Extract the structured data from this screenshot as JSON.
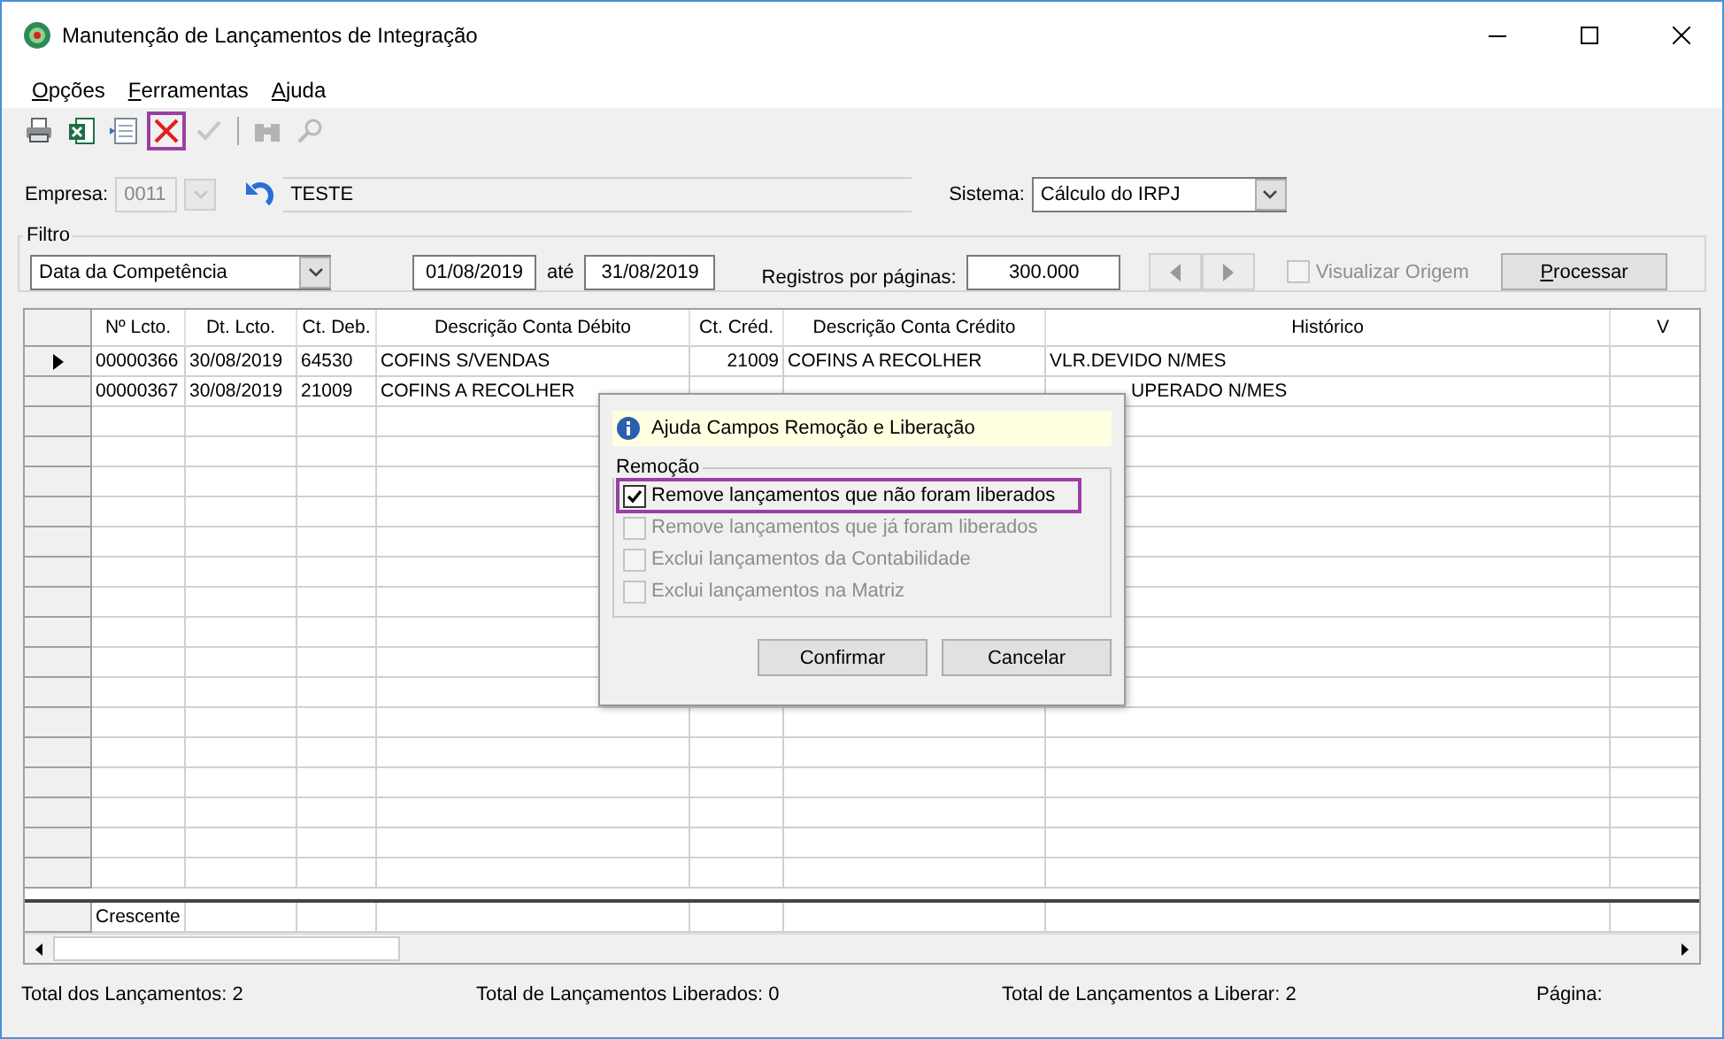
{
  "window": {
    "title": "Manutenção de Lançamentos de Integração"
  },
  "menu": [
    "Opções",
    "Ferramentas",
    "Ajuda"
  ],
  "toolbar": [
    {
      "kind": "printer",
      "disabled": false,
      "highlighted": false
    },
    {
      "kind": "excel",
      "disabled": false,
      "highlighted": false
    },
    {
      "kind": "notes",
      "disabled": false,
      "highlighted": false
    },
    {
      "kind": "delete",
      "disabled": false,
      "highlighted": true
    },
    {
      "kind": "check",
      "disabled": true,
      "highlighted": false
    },
    {
      "kind": "separator"
    },
    {
      "kind": "binoculars",
      "disabled": true,
      "highlighted": false
    },
    {
      "kind": "magnifier",
      "disabled": true,
      "highlighted": false
    }
  ],
  "empresa": {
    "label": "Empresa:",
    "code": "0011",
    "name": "TESTE"
  },
  "sistema": {
    "label": "Sistema:",
    "value": "Cálculo do IRPJ"
  },
  "filtro": {
    "title": "Filtro",
    "field": "Data da Competência",
    "date_from": "01/08/2019",
    "until_label": "até",
    "date_to": "31/08/2019",
    "per_page_label": "Registros por páginas:",
    "per_page": "300.000",
    "visualizar": {
      "label": "Visualizar Origem",
      "checked": false,
      "disabled": true
    },
    "process_button": "Processar"
  },
  "grid": {
    "columns": [
      "Nº Lcto.",
      "Dt. Lcto.",
      "Ct. Deb.",
      "Descrição Conta Débito",
      "Ct. Créd.",
      "Descrição Conta Crédito",
      "Histórico",
      "V"
    ],
    "rows": [
      {
        "selected": true,
        "covered_by_dialog": false,
        "cells": [
          "00000366",
          "30/08/2019",
          "64530",
          "COFINS S/VENDAS",
          "21009",
          "COFINS A RECOLHER",
          "VLR.DEVIDO N/MES"
        ]
      },
      {
        "selected": false,
        "covered_by_dialog": true,
        "cells": [
          "00000367",
          "30/08/2019",
          "21009",
          "COFINS A RECOLHER",
          null,
          null,
          "UPERADO N/MES"
        ]
      }
    ],
    "footer": "Crescente"
  },
  "dialog": {
    "title": "Ajuda Campos Remoção e Liberação",
    "group": "Remoção",
    "options": [
      {
        "label": "Remove lançamentos que não foram liberados",
        "checked": true,
        "disabled": false,
        "highlighted": true
      },
      {
        "label": "Remove lançamentos que já foram liberados",
        "checked": false,
        "disabled": true,
        "highlighted": false
      },
      {
        "label": "Exclui lançamentos da Contabilidade",
        "checked": false,
        "disabled": true,
        "highlighted": false
      },
      {
        "label": "Exclui lançamentos na Matriz",
        "checked": false,
        "disabled": true,
        "highlighted": false
      }
    ],
    "buttons": [
      "Confirmar",
      "Cancelar"
    ]
  },
  "status": [
    "Total dos Lançamentos: 2",
    "Total de Lançamentos Liberados: 0",
    "Total de Lançamentos a Liberar: 2",
    "Página:"
  ]
}
